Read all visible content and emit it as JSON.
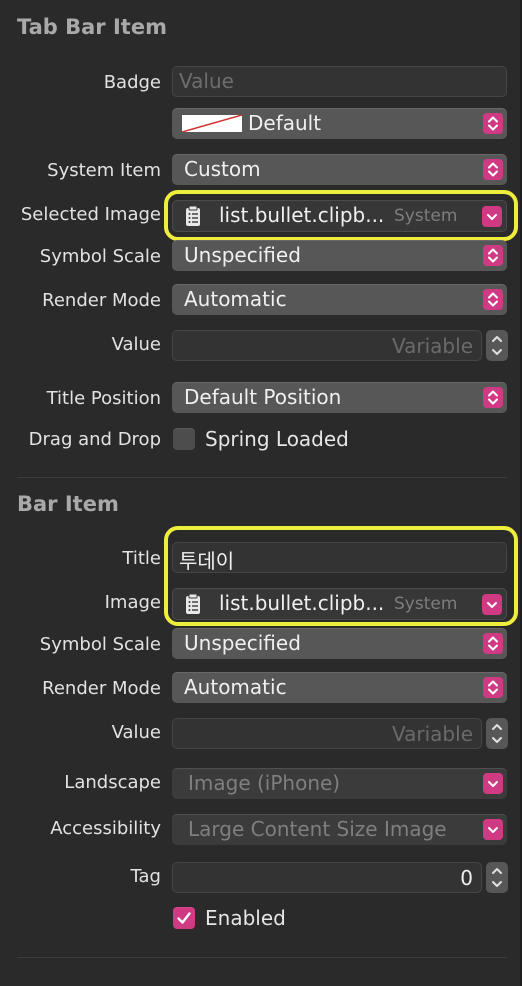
{
  "tab_bar_item": {
    "section_title": "Tab Bar Item",
    "badge": {
      "label": "Badge",
      "placeholder": "Value"
    },
    "badge_color": {
      "value": "Default"
    },
    "system_item": {
      "label": "System Item",
      "value": "Custom"
    },
    "selected_image": {
      "label": "Selected Image",
      "value": "list.bullet.clipb...",
      "source": "System"
    },
    "symbol_scale": {
      "label": "Symbol Scale",
      "value": "Unspecified"
    },
    "render_mode": {
      "label": "Render Mode",
      "value": "Automatic"
    },
    "value": {
      "label": "Value",
      "placeholder": "Variable"
    },
    "title_position": {
      "label": "Title Position",
      "value": "Default Position"
    },
    "drag_and_drop": {
      "label": "Drag and Drop",
      "checkbox_label": "Spring Loaded",
      "checked": false
    }
  },
  "bar_item": {
    "section_title": "Bar Item",
    "title": {
      "label": "Title",
      "value": "투데이"
    },
    "image": {
      "label": "Image",
      "value": "list.bullet.clipb...",
      "source": "System"
    },
    "symbol_scale": {
      "label": "Symbol Scale",
      "value": "Unspecified"
    },
    "render_mode": {
      "label": "Render Mode",
      "value": "Automatic"
    },
    "value": {
      "label": "Value",
      "placeholder": "Variable"
    },
    "landscape": {
      "label": "Landscape",
      "value": "Image (iPhone)"
    },
    "accessibility": {
      "label": "Accessibility",
      "value": "Large Content Size Image"
    },
    "tag": {
      "label": "Tag",
      "value": "0"
    },
    "enabled": {
      "checkbox_label": "Enabled",
      "checked": true
    }
  },
  "colors": {
    "accent": "#d03a83",
    "highlight": "#f0ee3c",
    "background": "#2a2a2a"
  },
  "icons": {
    "popup_arrows": "updown-chevron-icon",
    "combo_arrow": "chevron-down-icon",
    "symbol": "clipboard-icon",
    "stepper": "stepper-arrows-icon",
    "check": "checkmark-icon"
  }
}
